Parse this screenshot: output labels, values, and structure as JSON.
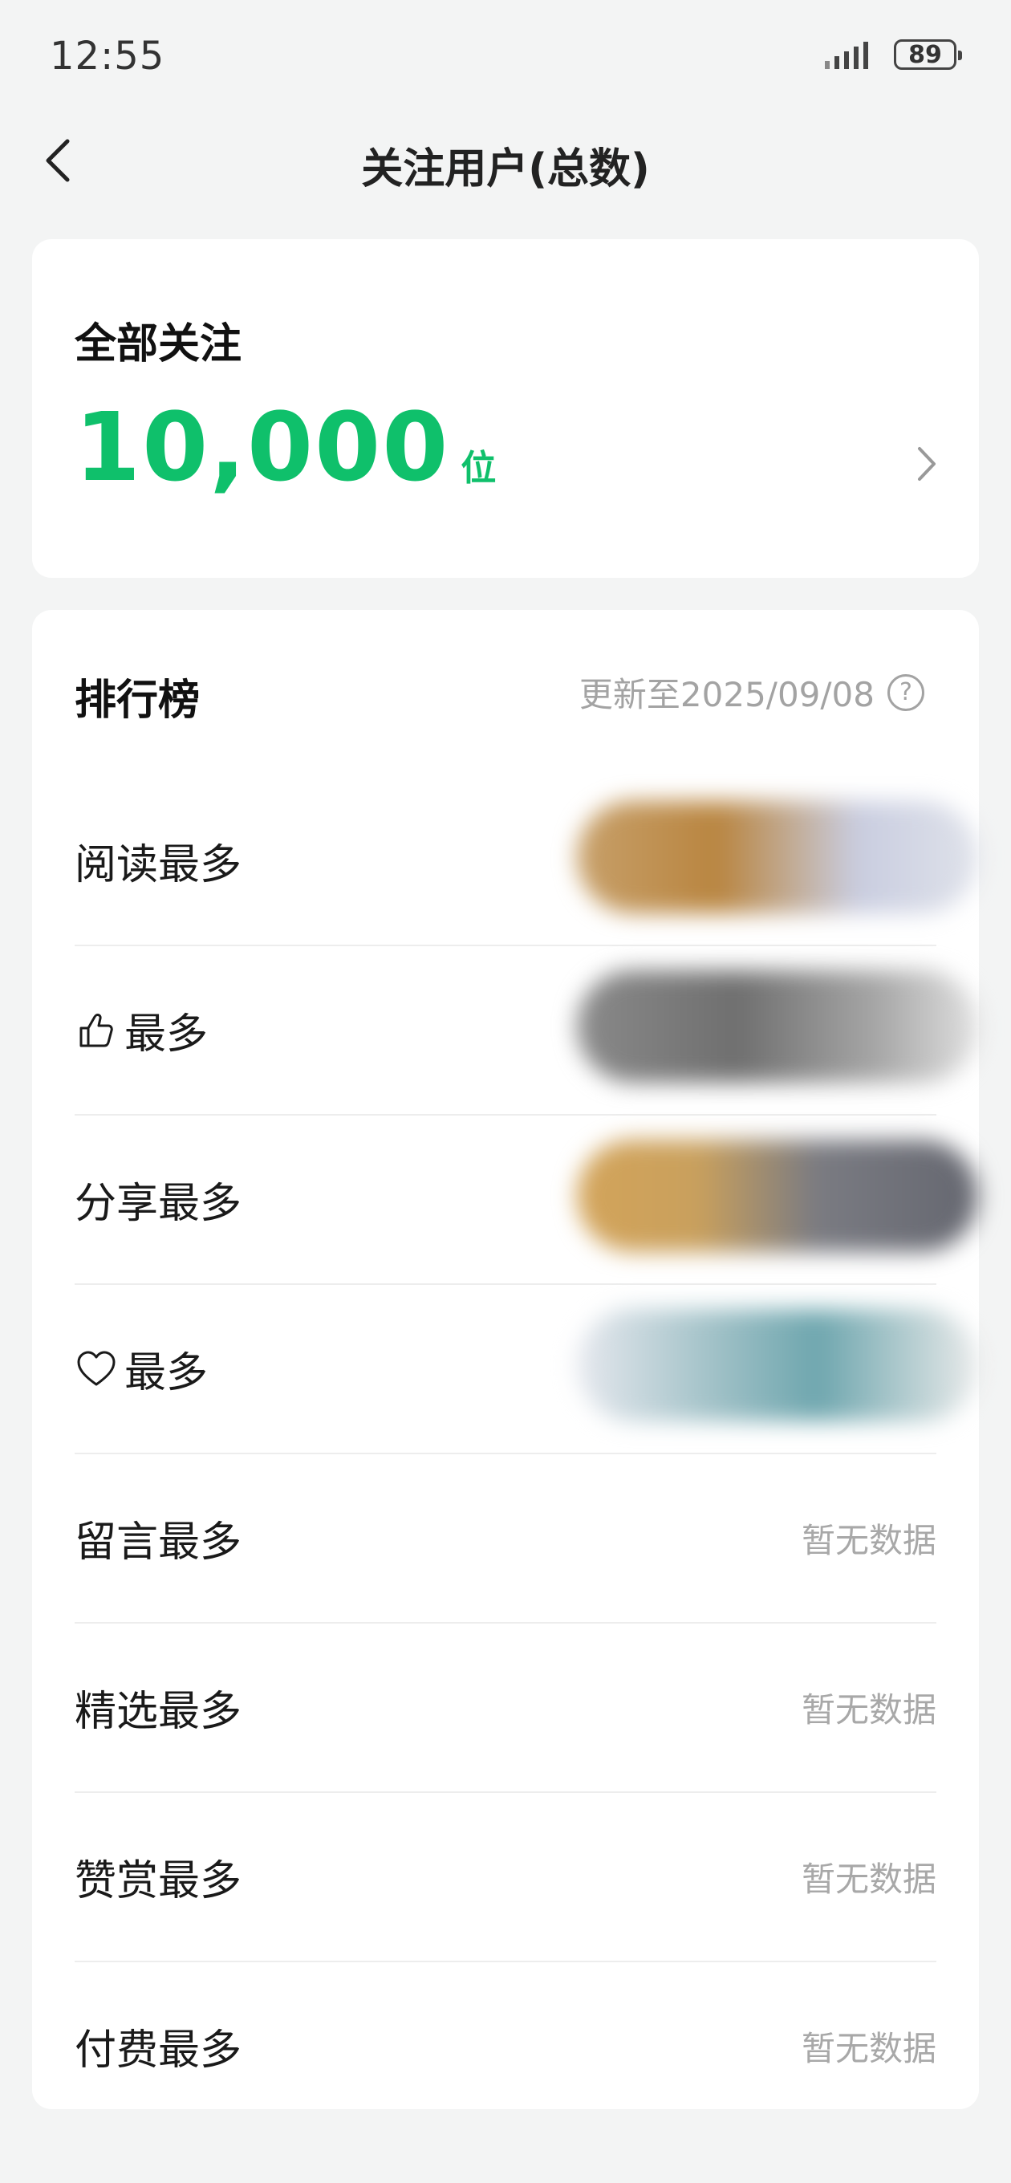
{
  "status": {
    "time": "12:55",
    "battery": "89"
  },
  "nav": {
    "title": "关注用户(总数)"
  },
  "total": {
    "label": "全部关注",
    "value": "10,000",
    "unit": "位"
  },
  "ranking": {
    "title": "排行榜",
    "update_text": "更新至2025/09/08",
    "help_glyph": "?",
    "items": [
      {
        "label": "阅读最多",
        "value": ""
      },
      {
        "label": "最多",
        "value": ""
      },
      {
        "label": "分享最多",
        "value": ""
      },
      {
        "label": "最多",
        "value": ""
      },
      {
        "label": "留言最多",
        "value": "暂无数据"
      },
      {
        "label": "精选最多",
        "value": "暂无数据"
      },
      {
        "label": "赞赏最多",
        "value": "暂无数据"
      },
      {
        "label": "付费最多",
        "value": "暂无数据"
      }
    ]
  },
  "colors": {
    "accent": "#0fc06b",
    "muted": "#a8a8a8",
    "background": "#f3f4f4"
  },
  "icons": [
    "back-arrow-icon",
    "chevron-right-icon",
    "help-icon",
    "thumbs-up-icon",
    "heart-icon",
    "signal-icon",
    "battery-icon"
  ]
}
